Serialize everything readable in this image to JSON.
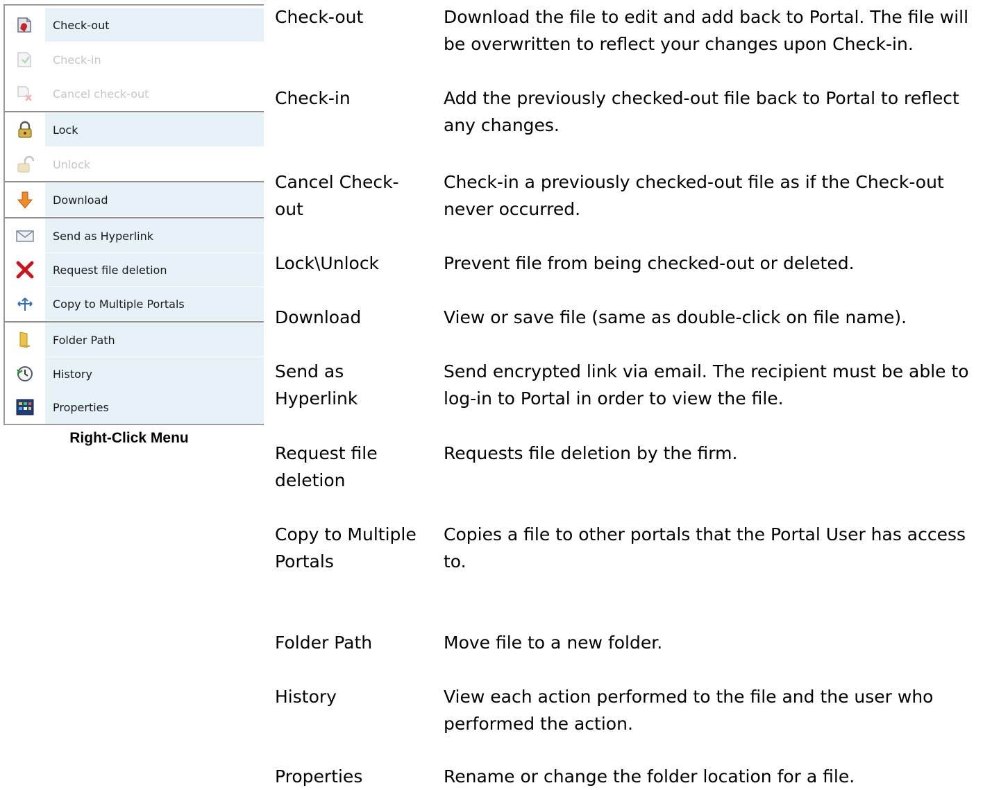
{
  "menu": {
    "items": [
      {
        "label": "Check-out",
        "icon": "check-out-icon",
        "enabled": true
      },
      {
        "label": "Check-in",
        "icon": "check-in-icon",
        "enabled": false
      },
      {
        "label": "Cancel check-out",
        "icon": "cancel-check-out-icon",
        "enabled": false
      },
      {
        "label": "Lock",
        "icon": "lock-icon",
        "enabled": true
      },
      {
        "label": "Unlock",
        "icon": "unlock-icon",
        "enabled": false
      },
      {
        "label": "Download",
        "icon": "download-arrow-icon",
        "enabled": true
      },
      {
        "label": "Send as Hyperlink",
        "icon": "envelope-icon",
        "enabled": true
      },
      {
        "label": "Request file deletion",
        "icon": "red-x-icon",
        "enabled": true
      },
      {
        "label": "Copy to Multiple Portals",
        "icon": "copy-arrows-icon",
        "enabled": true
      },
      {
        "label": "Folder Path",
        "icon": "folder-icon",
        "enabled": true
      },
      {
        "label": "History",
        "icon": "clock-history-icon",
        "enabled": true
      },
      {
        "label": "Properties",
        "icon": "properties-grid-icon",
        "enabled": true
      }
    ],
    "caption": "Right-Click Menu"
  },
  "descriptions": [
    {
      "term": "Check-out",
      "text": "Download the file to edit and add back to Portal. The file will be overwritten to reflect your changes upon Check-in."
    },
    {
      "term": "Check-in",
      "text": "Add the previously checked-out file back to Portal to reflect any changes."
    },
    {
      "term": "Cancel Check-out",
      "text": "Check-in a previously checked-out file as if the Check-out never occurred."
    },
    {
      "term": "Lock\\Unlock",
      "text": "Prevent file from being checked-out or deleted."
    },
    {
      "term": "Download",
      "text": "View or save file (same as double-click on file name)."
    },
    {
      "term": "Send as Hyperlink",
      "text": "Send encrypted link via email. The recipient must be able to log-in to Portal in order to view the file."
    },
    {
      "term": "Request file deletion",
      "text": "Requests file deletion by the firm."
    },
    {
      "term": "Copy to Multiple Portals",
      "text": "Copies a file to other portals that the Portal User has access to."
    },
    {
      "term": "Folder Path",
      "text": "Move file to a new folder."
    },
    {
      "term": "History",
      "text": "View each action performed to the file and the user who performed the action."
    },
    {
      "term": "Properties",
      "text": "Rename or change the folder location for a file."
    }
  ]
}
